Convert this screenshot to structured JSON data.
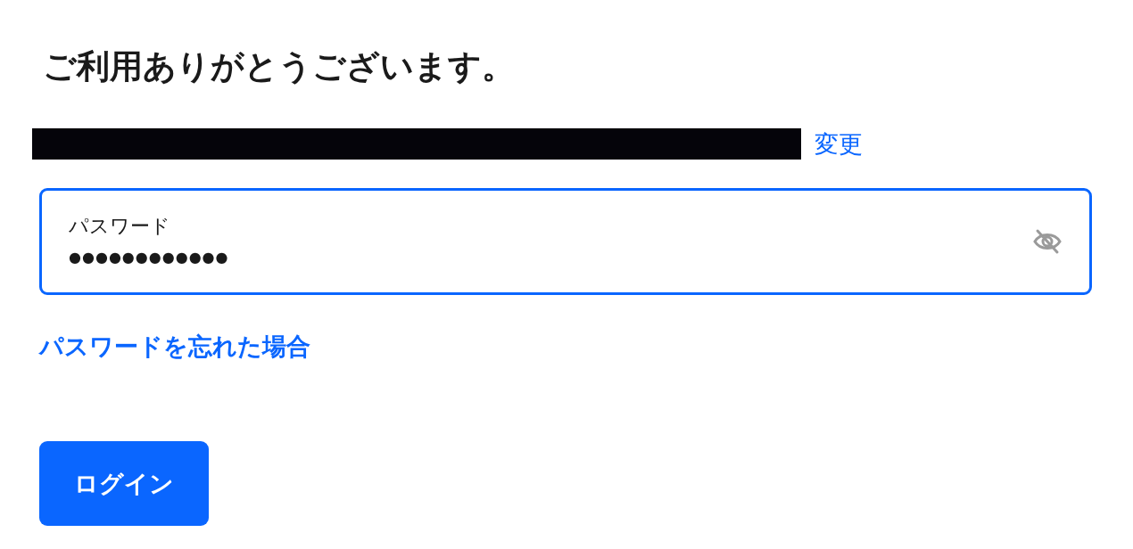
{
  "heading": "ご利用ありがとうございます。",
  "account": {
    "change_link": "変更"
  },
  "password_field": {
    "label": "パスワード",
    "value": "●●●●●●●●●●●●",
    "focused": true
  },
  "forgot_link": "パスワードを忘れた場合",
  "login_button": "ログイン"
}
